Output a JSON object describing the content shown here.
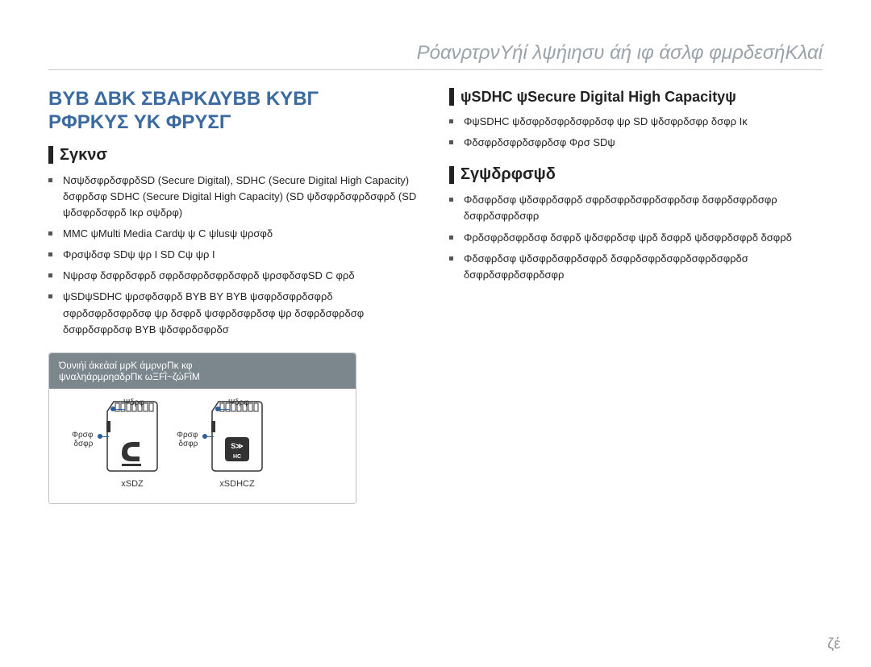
{
  "header": "ΡόανρτρνΥήί λψήιησυ άή ιφ άσλφ φμρδεσήΚλαί",
  "left": {
    "title_l1": "ΒΥΒ ΔΒΚ ΣΒΑΡΚΔΥΒΒ ΚΥΒΓ",
    "title_l2": "ΡΦΡΚΥΣ ΥΚ ΦΡΥΣΓ",
    "subhead": "Σγκνσ",
    "bullets": [
      "ΝσψδσφρδσφρδSD (Secure Digital), SDHC (Secure Digital High Capacity) δσφρδσφ SDHC (Secure Digital High Capacity) (SD ψδσφρδσφρδσφρδ (SD ψδσφρδσφρδ Ικρ σψδρφ)",
      "MMC ψMulti Media Cardψ ψ C ψlusψ ψρσφδ",
      "Φρσψδσφ SDψ ψρ Ι SD Cψ ψρ Ι",
      "Νψρσφ δσφρδσφρδ σφρδσφρδσφρδσφρδ ψρσφδσφSD C φρδ",
      "ψSDψSDHC ψρσφδσφρδ ΒΥΒ ΒΥ ΒΥΒ ψσφρδσφρδσφρδ σφρδσφρδσφρδσφ ψρ δσφρδ ψσφρδσφρδσφ ψρ δσφρδσφρδσφ δσφρδσφρδσφ ΒΥΒ ψδσφρδσφρδσ"
    ],
    "card_caption_l1": "Όυνιήί άκεάαί μρK άμρνρΠκ κφ",
    "card_caption_l2": "ψναληάρμρηαδρΠκ ωΞFῒ~ζώFῒM",
    "lbl_top": "Ψδρφ",
    "lbl_left1": "Φρσφ",
    "lbl_left2": "δσφρ",
    "name_sd": "xSDZ",
    "name_sdhc": "xSDHCZ"
  },
  "right": {
    "subhead_sdhc": "ψSDHC ψSecure Digital High Capacityψ",
    "bullets_top": [
      "ΦψSDHC ψδσφρδσφρδσφρδσφ ψρ SD ψδσφρδσφρ δσφρ Ικ",
      "Φδσφρδσφρδσφρδσφ Φρσ SDψ"
    ],
    "subhead2": "Σγψδρφσψδ",
    "bullets_bot": [
      "Φδσφρδσφ ψδσφρδσφρδ σφρδσφρδσφρδσφρδσφ δσφρδσφρδσφρ δσφρδσφρδσφρ",
      "Φρδσφρδσφρδσφ δσφρδ ψδσφρδσφ ψρδ δσφρδ ψδσφρδσφρδ δσφρδ",
      "Φδσφρδσφ ψδσφρδσφρδσφρδ δσφρδσφρδσφρδσφρδσφρδσ δσφρδσφρδσφρδσφρ"
    ]
  },
  "page_number": "ζέ"
}
